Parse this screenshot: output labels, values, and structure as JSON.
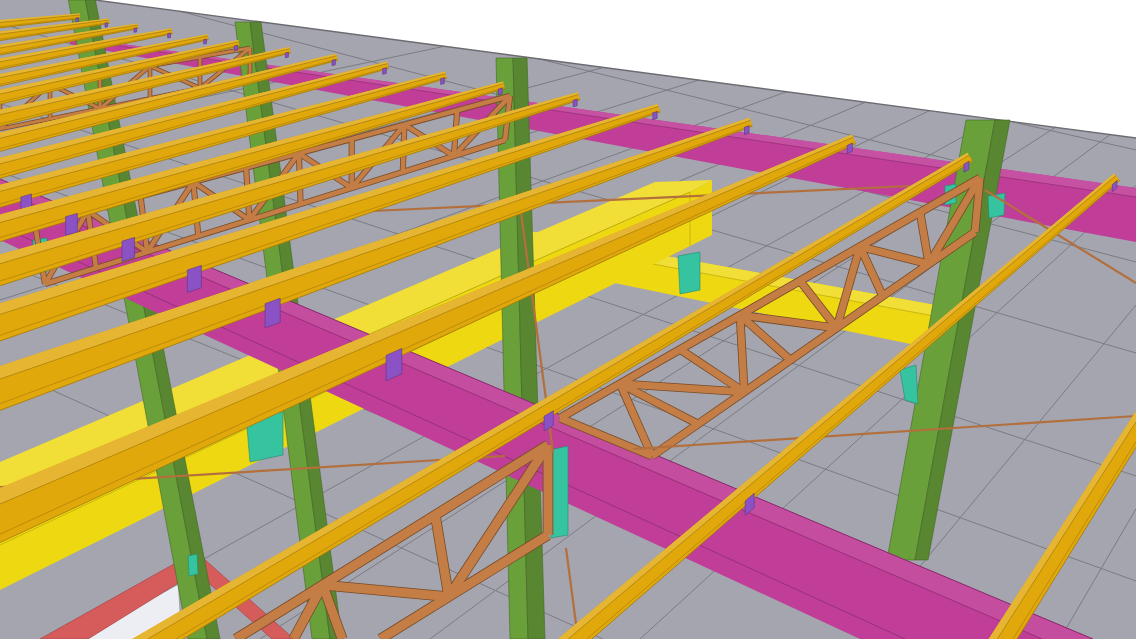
{
  "model_view": {
    "members": [
      {
        "kind": "floor",
        "color": "#a4a5ae"
      },
      {
        "kind": "panel",
        "color": "#eceef4"
      },
      {
        "kind": "tie-beam",
        "color": "#d65c5c"
      },
      {
        "kind": "beam",
        "color": "#c03e98"
      },
      {
        "kind": "crane-girder",
        "color": "#eed812"
      },
      {
        "kind": "column",
        "color": "#69a03a"
      },
      {
        "kind": "bracket",
        "color": "#35c3a0"
      },
      {
        "kind": "joist",
        "color": "#c47d45"
      },
      {
        "kind": "brace",
        "color": "#b36f3c"
      },
      {
        "kind": "purlin",
        "color": "#e1a80b"
      },
      {
        "kind": "clip",
        "color": "#8b52c6"
      }
    ]
  }
}
